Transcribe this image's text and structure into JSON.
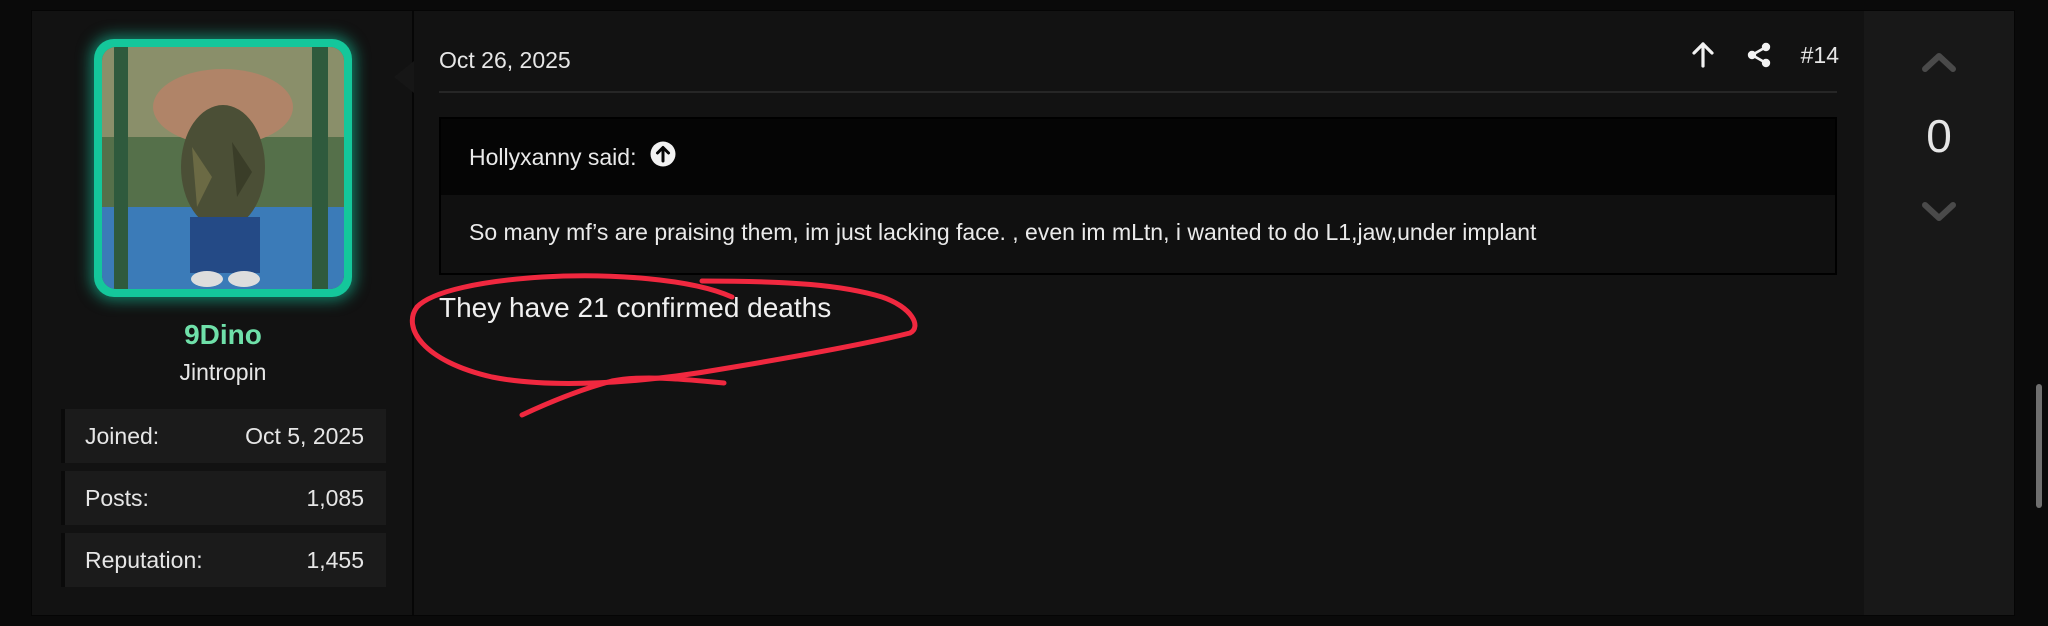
{
  "post": {
    "date": "Oct 26, 2025",
    "number": "#14",
    "quote": {
      "author_label": "Hollyxanny said:",
      "text": "So many mf’s are praising them, im just lacking face. , even im mLtn, i wanted to do L1,jaw,under implant"
    },
    "reply_text": "They have 21 confirmed deaths"
  },
  "user": {
    "name": "9Dino",
    "title": "Jintropin",
    "stats": [
      {
        "label": "Joined:",
        "value": "Oct 5, 2025"
      },
      {
        "label": "Posts:",
        "value": "1,085"
      },
      {
        "label": "Reputation:",
        "value": "1,455"
      }
    ]
  },
  "vote": {
    "count": "0"
  },
  "icons": {
    "jump": "arrow-up-icon",
    "share": "share-icon",
    "quote_jump": "circle-arrow-up-icon",
    "upvote": "chevron-up-icon",
    "downvote": "chevron-down-icon"
  },
  "colors": {
    "username": "#6fe0a9",
    "avatar_border": "#14c79b",
    "annotation": "#f0283f"
  }
}
